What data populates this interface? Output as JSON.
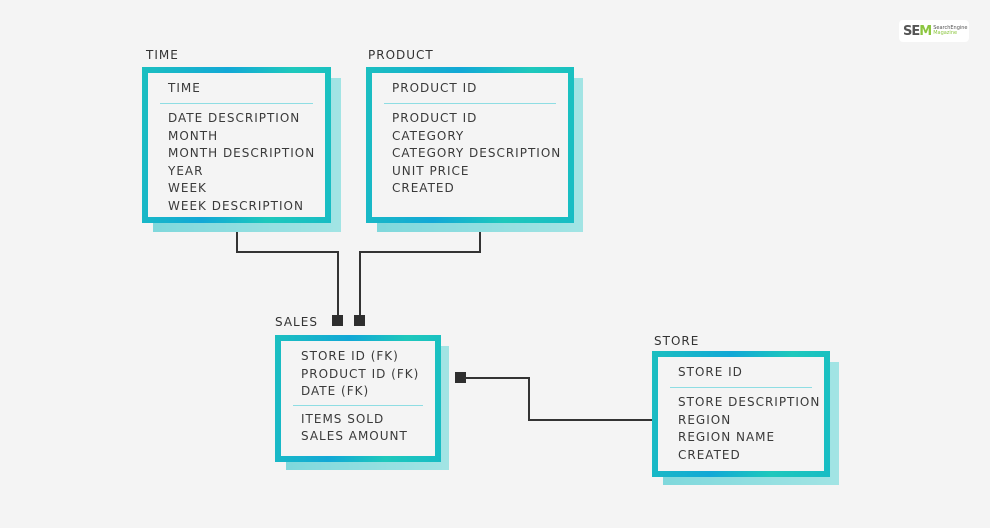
{
  "logo": {
    "text": "SEM",
    "sub1": "SearchEngine",
    "sub2": "Magazine"
  },
  "tables": {
    "time": {
      "label": "TIME",
      "header": "TIME",
      "fields": [
        "DATE DESCRIPTION",
        "MONTH",
        "MONTH DESCRIPTION",
        "YEAR",
        "WEEK",
        "WEEK DESCRIPTION"
      ]
    },
    "product": {
      "label": "PRODUCT",
      "header": "PRODUCT ID",
      "fields": [
        "PRODUCT ID",
        "CATEGORY",
        "CATEGORY DESCRIPTION",
        "UNIT PRICE",
        "CREATED"
      ]
    },
    "sales": {
      "label": "SALES",
      "keys": [
        "STORE ID (FK)",
        "PRODUCT ID (FK)",
        "DATE (FK)"
      ],
      "fields": [
        "ITEMS SOLD",
        "SALES AMOUNT"
      ]
    },
    "store": {
      "label": "STORE",
      "header": "STORE ID",
      "fields": [
        "STORE DESCRIPTION",
        "REGION",
        "REGION NAME",
        "CREATED"
      ]
    }
  },
  "colors": {
    "border": "#1bbfc0",
    "shadow": "#8fdede",
    "connector": "#333333"
  }
}
